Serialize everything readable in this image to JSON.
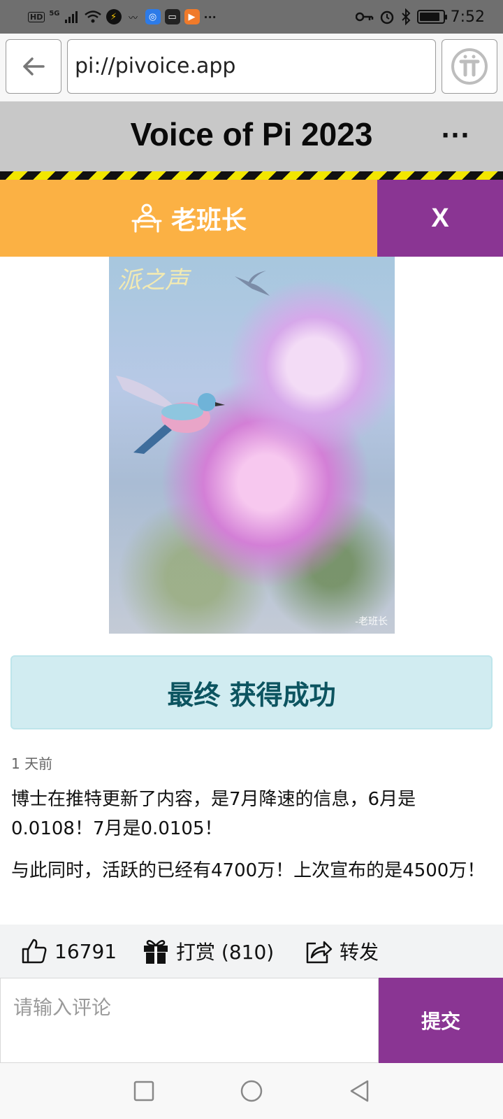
{
  "status_bar": {
    "hd": "HD",
    "network": "5G",
    "more": "···",
    "time": "7:52",
    "battery_level": 0.9,
    "icons": [
      "hd-icon",
      "signal-icon",
      "wifi-icon",
      "speedometer-icon",
      "link-icon",
      "browser-icon",
      "chat-icon",
      "video-app-icon",
      "key-icon",
      "alarm-icon",
      "bluetooth-icon",
      "battery-icon"
    ]
  },
  "browser": {
    "url": "pi://pivoice.app",
    "icons": [
      "back-arrow-icon",
      "pi-logo-icon"
    ]
  },
  "app": {
    "title": "Voice of Pi 2023",
    "menu": "···"
  },
  "author": {
    "name": "老班长",
    "close": "X",
    "icons": [
      "teacher-desk-icon"
    ]
  },
  "image": {
    "watermark_top": "派之声",
    "watermark_bottom": "-老班长"
  },
  "post": {
    "headline": "最终 获得成功",
    "time_ago": "1 天前",
    "paragraphs": [
      "博士在推特更新了内容，是7月降速的信息，6月是0.0108！7月是0.0105！",
      "与此同时，活跃的已经有4700万！上次宣布的是4500万！"
    ]
  },
  "actions": {
    "likes": "16791",
    "tip": "打赏 (810)",
    "share": "转发",
    "icons": [
      "thumbs-up-icon",
      "gift-icon",
      "share-icon"
    ]
  },
  "comment": {
    "placeholder": "请输入评论",
    "submit": "提交"
  },
  "colors": {
    "author_bar": "#fbb144",
    "accent_purple": "#8a3593",
    "header_gray": "#c8c8c8",
    "banner_bg": "#d1ecf1",
    "banner_text": "#0c5460",
    "hazard_yellow": "#f2e600"
  }
}
